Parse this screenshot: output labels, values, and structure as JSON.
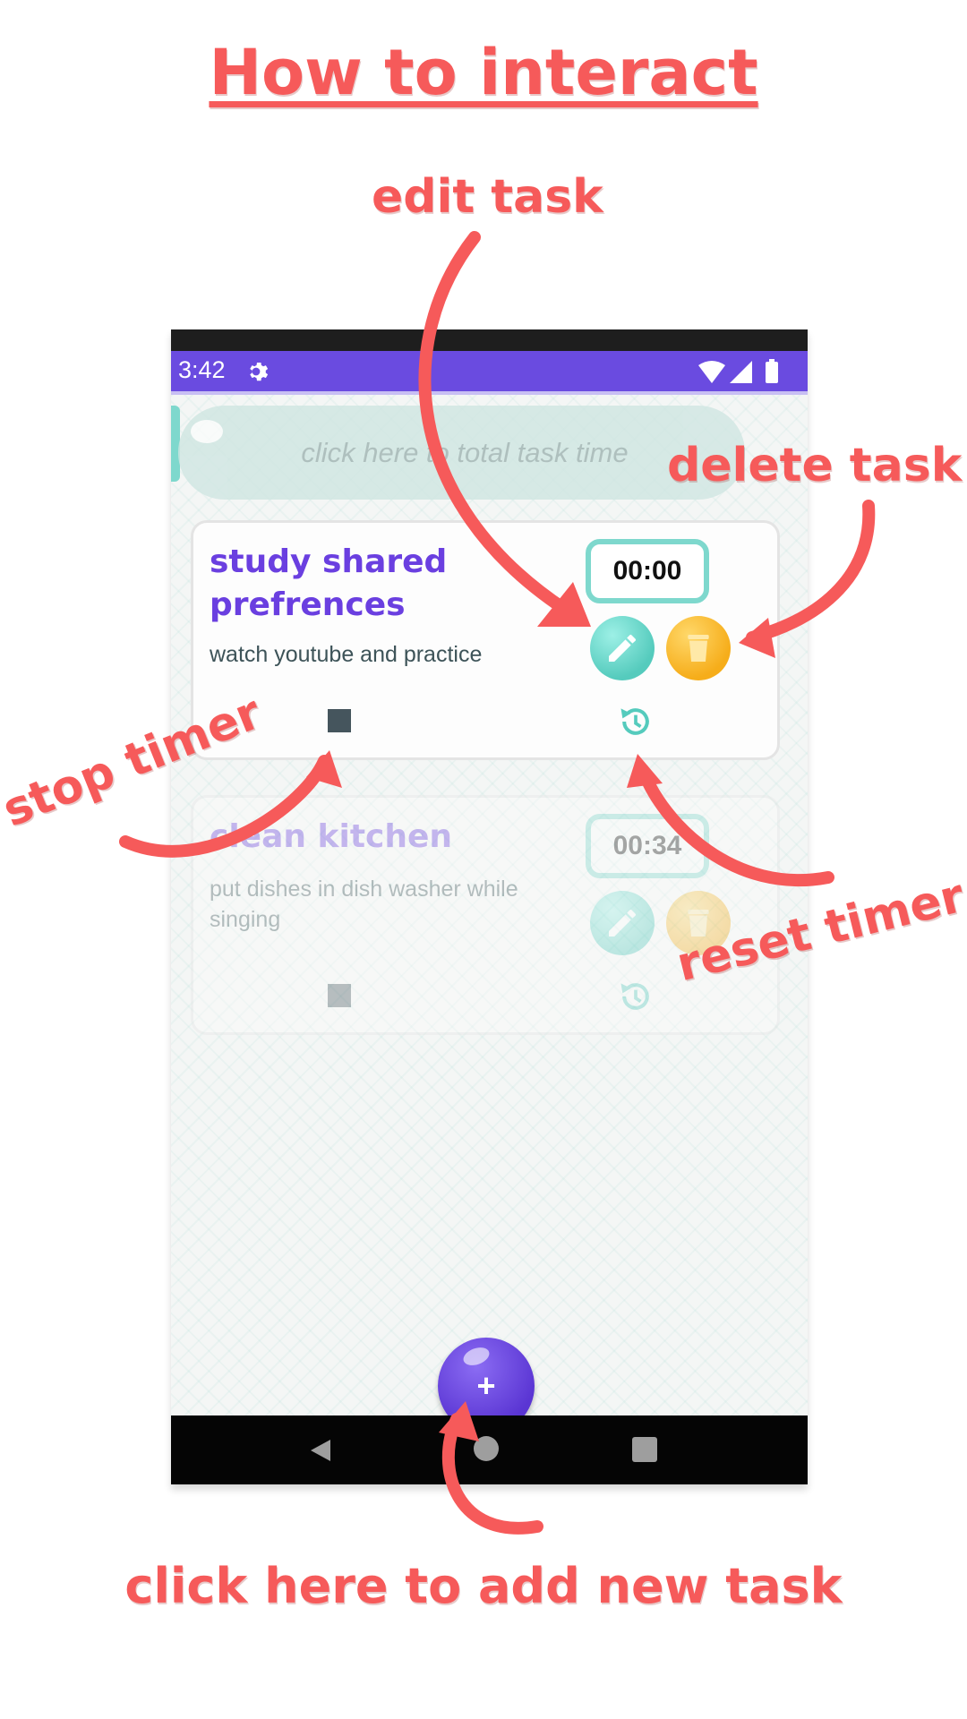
{
  "annotations": {
    "title": "How to interact",
    "edit": "edit task",
    "delete": "delete task",
    "stop": "stop timer",
    "reset": "reset timer",
    "add": "click here to add new task"
  },
  "status_bar": {
    "time": "3:42",
    "icons": [
      "settings-icon",
      "wifi-icon",
      "signal-icon",
      "battery-icon"
    ]
  },
  "total_time": {
    "label": "click here to total task time"
  },
  "tasks": [
    {
      "title": "study shared prefrences",
      "description": "watch youtube and practice",
      "timer": "00:00"
    },
    {
      "title": "clean kitchen",
      "description": "put dishes in dish washer while singing",
      "timer": "00:34"
    }
  ],
  "fab": {
    "label": "+"
  },
  "colors": {
    "annotation": "#f65a5a",
    "accent": "#6a4be0",
    "teal": "#7ed8cd",
    "delete": "#f6ad1a"
  }
}
